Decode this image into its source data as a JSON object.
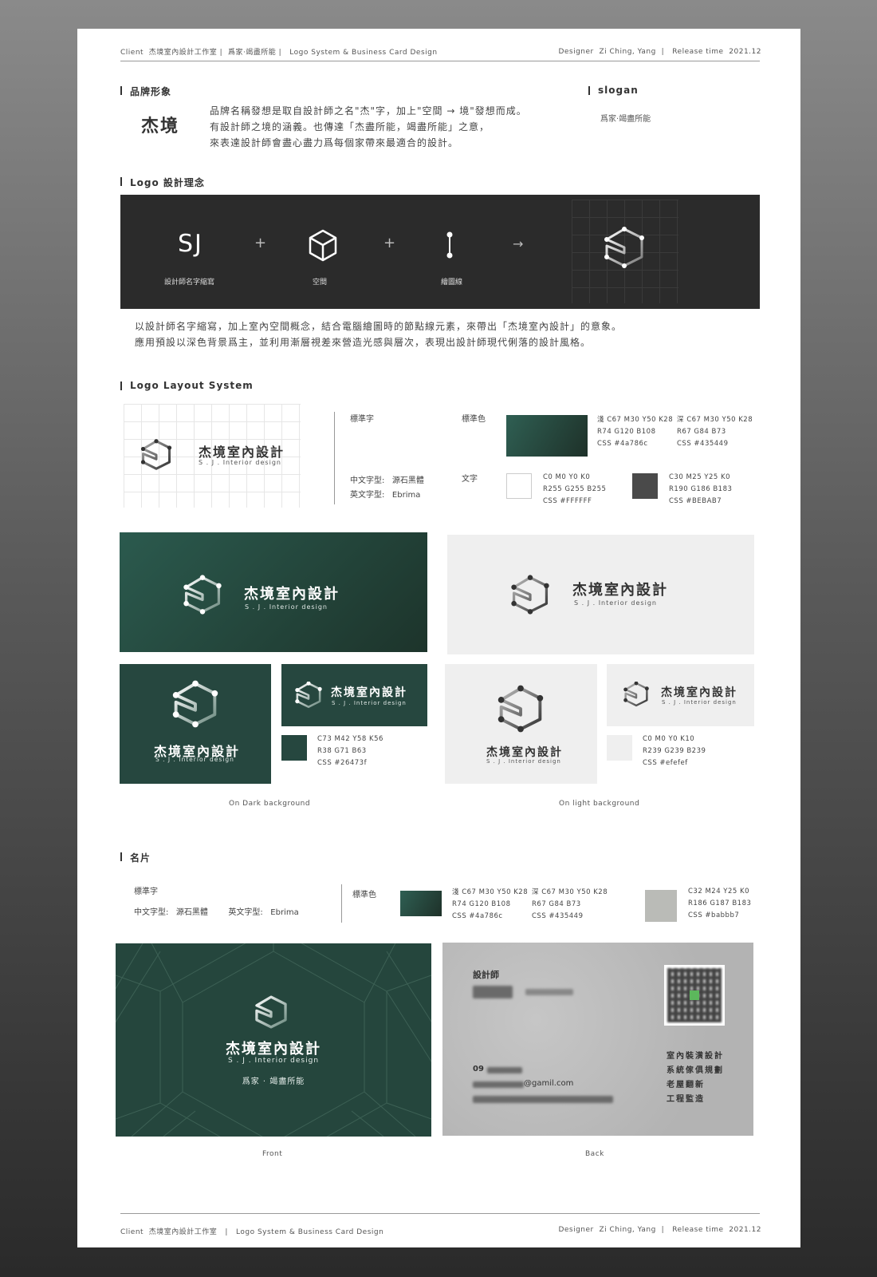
{
  "header": {
    "client_label": "Client",
    "client_name": "杰境室內設計工作室",
    "slogan_short": "爲家‧竭盡所能",
    "project": "Logo System & Business Card Design",
    "designer_label": "Designer",
    "designer": "Zi Ching, Yang",
    "release_label": "Release time",
    "release": "2021.12"
  },
  "brand": {
    "section_title": "品牌形象",
    "name": "杰境",
    "lines": [
      "品牌名稱發想是取自設計師之名\"杰\"字，加上\"空間 → 境\"發想而成。",
      "有設計師之境的涵義。也傳達「杰盡所能，竭盡所能」之意，",
      "來表達設計師會盡心盡力爲每個家帶來最適合的設計。"
    ],
    "slogan_title": "slogan",
    "slogan": "爲家‧竭盡所能"
  },
  "logo_concept": {
    "section_title": "Logo 設計理念",
    "sj": "SJ",
    "plus": "+",
    "arrow": "→",
    "labels": [
      "設計師名字縮寫",
      "空間",
      "繪圖線"
    ],
    "lines": [
      "以設計師名字縮寫，加上室內空間概念，結合電腦繪圖時的節點線元素，來帶出「杰境室內設計」的意象。",
      "應用預設以深色背景爲主，並利用漸層視差來營造光感與層次，表現出設計師現代俐落的設計風格。"
    ]
  },
  "layout_system": {
    "section_title": "Logo Layout System",
    "logo_name": "杰境室內設計",
    "logo_sub": "S . J . Interior design",
    "std_font_label": "標準字",
    "std_color_label": "標準色",
    "text_label": "文字",
    "cn_font_label": "中文字型:",
    "cn_font": "源石黑體",
    "en_font_label": "英文字型:",
    "en_font": "Ebrima",
    "color_specs": [
      [
        "淺 C67 M30 Y50 K28",
        "R74 G120 B108",
        "CSS #4a786c"
      ],
      [
        "深 C67 M30 Y50 K28",
        "R67 G84 B73",
        "CSS #435449"
      ],
      [
        "C0 M0 Y0 K0",
        "R255 G255 B255",
        "CSS #FFFFFF"
      ],
      [
        "C30 M25 Y25 K0",
        "R190 G186 B183",
        "CSS #BEBAB7"
      ]
    ],
    "colors": {
      "green_light": "#4a786c",
      "green_dark": "#435449",
      "green_main": "#26473f",
      "white": "#FFFFFF",
      "grey": "#BEBAB7",
      "light_bg": "#efefef",
      "grey_card": "#babbb7"
    }
  },
  "backgrounds": {
    "dark_spec": [
      "C73 M42 Y58 K56",
      "R38 G71 B63",
      "CSS #26473f"
    ],
    "light_spec": [
      "C0 M0 Y0 K10",
      "R239 G239 B239",
      "CSS #efefef"
    ],
    "dark_caption": "On Dark background",
    "light_caption": "On light background"
  },
  "card": {
    "section_title": "名片",
    "std_font_label": "標準字",
    "cn_font_label": "中文字型:",
    "cn_font": "源石黑體",
    "en_font_label": "英文字型:",
    "en_font": "Ebrima",
    "std_color_label": "標準色",
    "specs": [
      [
        "淺 C67 M30 Y50 K28",
        "R74 G120 B108",
        "CSS #4a786c"
      ],
      [
        "深 C67 M30 Y50 K28",
        "R67 G84 B73",
        "CSS #435449"
      ],
      [
        "C32 M24 Y25 K0",
        "R186 G187 B183",
        "CSS #babbb7"
      ]
    ],
    "front_name": "杰境室內設計",
    "front_sub": "S . J . Interior design",
    "front_slogan": "爲家 · 竭盡所能",
    "back_role": "設計師",
    "back_phone": "09",
    "back_email": "@gamil.com",
    "services": [
      "室內裝潢設計",
      "系統傢俱規劃",
      "老屋翻新",
      "工程監造"
    ],
    "front_caption": "Front",
    "back_caption": "Back"
  }
}
